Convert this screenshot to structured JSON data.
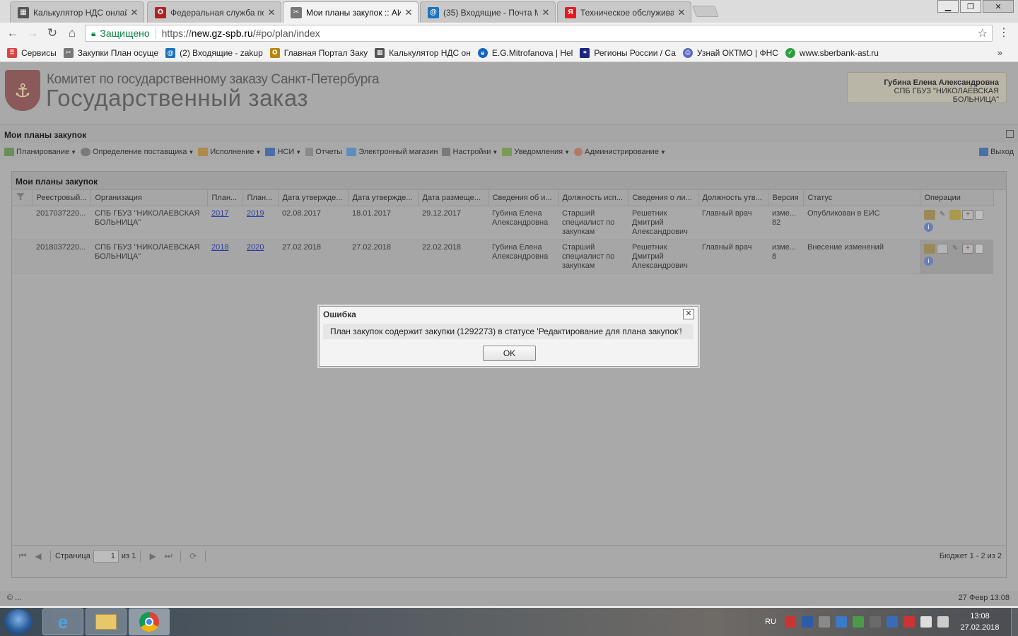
{
  "browser": {
    "tabs": [
      {
        "title": "Калькулятор НДС онлай",
        "icon": "calculator-icon",
        "color": "#555555"
      },
      {
        "title": "Федеральная служба по",
        "icon": "emblem-icon",
        "color": "#b22222"
      },
      {
        "title": "Мои планы закупок :: АИ",
        "icon": "tools-icon",
        "color": "#777777",
        "active": true
      },
      {
        "title": "(35) Входящие - Почта М",
        "icon": "mail-at-icon",
        "color": "#1e73be"
      },
      {
        "title": "Техническое обслуживан",
        "icon": "yandex-icon",
        "color": "#e31b23"
      }
    ],
    "tab_close": "✕",
    "address": {
      "secure_label": "Защищено",
      "scheme": "https://",
      "host": "new.gz-spb.ru",
      "path": "/#po/plan/index"
    },
    "bookmarks": [
      {
        "label": "Сервисы",
        "icon": "apps-grid-icon",
        "color": "#d44"
      },
      {
        "label": "Закупки План осуще",
        "icon": "tools-icon",
        "color": "#777"
      },
      {
        "label": "(2) Входящие - zakup",
        "icon": "mail-at-icon",
        "color": "#1e73be"
      },
      {
        "label": "Главная Портал Заку",
        "icon": "emblem-icon",
        "color": "#b8860b"
      },
      {
        "label": "Калькулятор НДС он",
        "icon": "calculator-icon",
        "color": "#555"
      },
      {
        "label": "E.G.Mitrofanova | Hel",
        "icon": "globe-icon",
        "color": "#1565c0"
      },
      {
        "label": "Регионы России / Са",
        "icon": "star-emblem-icon",
        "color": "#1a237e"
      },
      {
        "label": "Узнай ОКТМО | ФНС",
        "icon": "fns-icon",
        "color": "#5c6bc0"
      },
      {
        "label": "www.sberbank-ast.ru",
        "icon": "sber-icon",
        "color": "#2e9e3f"
      }
    ],
    "bookmarks_more": "»"
  },
  "header": {
    "org_line": "Комитет по государственному заказу Санкт-Петербурга",
    "title": "Государственный заказ",
    "user_name": "Губина Елена Александровна",
    "user_org": "СПБ ГБУЗ \"НИКОЛАЕВСКАЯ БОЛЬНИЦА\""
  },
  "panel_title": "Мои планы закупок",
  "menu": [
    {
      "label": "Планирование",
      "icon": "planning-icon",
      "color": "#6a8f5a",
      "dropdown": true
    },
    {
      "label": "Определение поставщика",
      "icon": "gears-icon",
      "color": "#7a7a7a",
      "dropdown": true
    },
    {
      "label": "Исполнение",
      "icon": "execution-icon",
      "color": "#b08a4a",
      "dropdown": true
    },
    {
      "label": "НСИ",
      "icon": "book-icon",
      "color": "#4a6fa8",
      "dropdown": true
    },
    {
      "label": "Отчеты",
      "icon": "report-icon",
      "color": "#8a8a8a",
      "dropdown": false
    },
    {
      "label": "Электронный магазин",
      "icon": "cart-icon",
      "color": "#5a8fc0",
      "dropdown": false
    },
    {
      "label": "Настройки",
      "icon": "wrench-icon",
      "color": "#7a7a7a",
      "dropdown": true
    },
    {
      "label": "Уведомления",
      "icon": "notifications-icon",
      "color": "#7a9a5a",
      "dropdown": true
    },
    {
      "label": "Администрирование",
      "icon": "user-icon",
      "color": "#b07a6a",
      "dropdown": true
    }
  ],
  "exit_label": "Выход",
  "grid": {
    "title": "Мои планы закупок",
    "columns": [
      "",
      "Реестровый...",
      "Организация",
      "План...",
      "План...",
      "Дата утвержде...",
      "Дата утвержде...",
      "Дата размеще...",
      "Сведения об и...",
      "Должность исп...",
      "Сведения о ли...",
      "Должность утв...",
      "Версия",
      "Статус",
      "Операции"
    ],
    "rows": [
      {
        "reg": "2017037220...",
        "org": "СПБ ГБУЗ \"НИКОЛАЕВСКАЯ БОЛЬНИЦА\"",
        "plan_from": "2017",
        "plan_to": "2019",
        "date_approved_1": "02.08.2017",
        "date_approved_2": "18.01.2017",
        "date_posted": "29.12.2017",
        "executor": "Губина Елена Александровна",
        "executor_position": "Старший специалист по закупкам",
        "approver": "Решетник Дмитрий Александрович",
        "approver_position": "Главный врач",
        "version": "изме... 82",
        "status": "Опубликован в ЕИС"
      },
      {
        "reg": "2018037220...",
        "org": "СПБ ГБУЗ \"НИКОЛАЕВСКАЯ БОЛЬНИЦА\"",
        "plan_from": "2018",
        "plan_to": "2020",
        "date_approved_1": "27.02.2018",
        "date_approved_2": "27.02.2018",
        "date_posted": "22.02.2018",
        "executor": "Губина Елена Александровна",
        "executor_position": "Старший специалист по закупкам",
        "approver": "Решетник Дмитрий Александрович",
        "approver_position": "Главный врач",
        "version": "изме... 8",
        "status": "Внесение изменений"
      }
    ]
  },
  "pager": {
    "page_label": "Страница",
    "page_value": "1",
    "of_label": "из 1",
    "info": "Бюджет 1 - 2 из 2"
  },
  "footer": {
    "copyright": "© ...",
    "datetime": "27 Февр 13:08"
  },
  "modal": {
    "title": "Ошибка",
    "message": "План закупок содержит закупки (1292273) в статусе 'Редактирование для плана закупок'!",
    "ok_label": "OK",
    "close": "✕"
  },
  "taskbar": {
    "lang": "RU",
    "time": "13:08",
    "date": "27.02.2018"
  }
}
